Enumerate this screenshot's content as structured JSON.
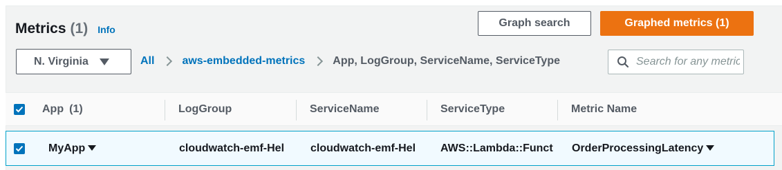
{
  "header": {
    "title": "Metrics",
    "count": "(1)",
    "info_label": "Info",
    "graph_search_label": "Graph search",
    "graphed_metrics_label": "Graphed metrics (1)"
  },
  "region": {
    "label": "N. Virginia"
  },
  "breadcrumb": {
    "all": "All",
    "namespace": "aws-embedded-metrics",
    "dimensions": "App, LogGroup, ServiceName, ServiceType"
  },
  "search": {
    "placeholder": "Search for any metric",
    "value": ""
  },
  "table": {
    "headers": {
      "app": "App",
      "app_count": "(1)",
      "log_group": "LogGroup",
      "service_name": "ServiceName",
      "service_type": "ServiceType",
      "metric_name": "Metric Name"
    },
    "rows": [
      {
        "app": "MyApp",
        "log_group": "cloudwatch-emf-Hel",
        "service_name": "cloudwatch-emf-Hel",
        "service_type": "AWS::Lambda::Funct",
        "metric_name": "OrderProcessingLatency",
        "selected": true
      }
    ]
  },
  "colors": {
    "accent": "#0073bb",
    "primary_button": "#ec7211",
    "selected_row_bg": "#f1faff",
    "selected_row_border": "#00a1c9"
  }
}
